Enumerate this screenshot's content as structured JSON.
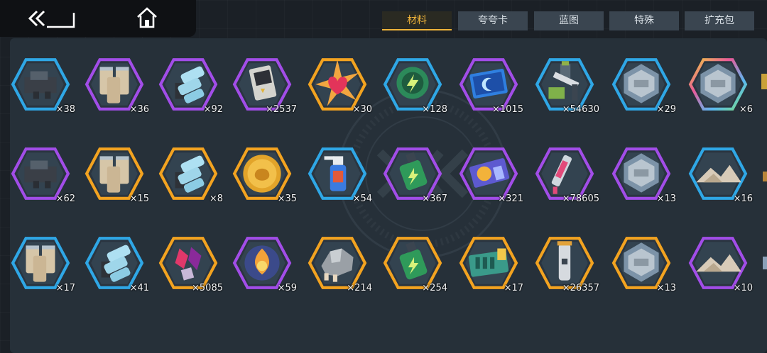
{
  "colors": {
    "active_tab": "#f0b43a",
    "tab_bg": "#3a4550",
    "rarity": {
      "blue": "#2fa7e6",
      "purple": "#a24de8",
      "gold": "#f3a320",
      "rainbow": "#e85a9a"
    }
  },
  "nav": {
    "back_icon": "double-chevron-back-icon",
    "home_icon": "home-icon"
  },
  "tabs": [
    {
      "label": "材料",
      "active": true
    },
    {
      "label": "夸夸卡",
      "active": false
    },
    {
      "label": "蓝图",
      "active": false
    },
    {
      "label": "特殊",
      "active": false
    },
    {
      "label": "扩充包",
      "active": false
    }
  ],
  "items": [
    {
      "qty": "×38",
      "rarity": "blue",
      "icon": "dark-machine-part-icon"
    },
    {
      "qty": "×36",
      "rarity": "purple",
      "icon": "battery-pack-icon"
    },
    {
      "qty": "×92",
      "rarity": "purple",
      "icon": "capacitor-cluster-icon"
    },
    {
      "qty": "×2537",
      "rarity": "purple",
      "icon": "battery-cell-icon"
    },
    {
      "qty": "×30",
      "rarity": "gold",
      "icon": "heart-burst-icon"
    },
    {
      "qty": "×128",
      "rarity": "blue",
      "icon": "energy-chip-icon"
    },
    {
      "qty": "×1015",
      "rarity": "purple",
      "icon": "moon-card-icon"
    },
    {
      "qty": "×54630",
      "rarity": "blue",
      "icon": "robot-arm-icon"
    },
    {
      "qty": "×29",
      "rarity": "blue",
      "icon": "hex-plate-icon"
    },
    {
      "qty": "×6",
      "rarity": "rainbow",
      "icon": "hex-plate-icon"
    },
    {
      "qty": "×62",
      "rarity": "purple",
      "icon": "dark-machine-part-icon"
    },
    {
      "qty": "×15",
      "rarity": "gold",
      "icon": "battery-pack-icon"
    },
    {
      "qty": "×8",
      "rarity": "gold",
      "icon": "capacitor-cluster-icon"
    },
    {
      "qty": "×35",
      "rarity": "gold",
      "icon": "gold-coin-icon"
    },
    {
      "qty": "×54",
      "rarity": "blue",
      "icon": "spray-bottle-icon"
    },
    {
      "qty": "×367",
      "rarity": "purple",
      "icon": "energy-drink-icon"
    },
    {
      "qty": "×321",
      "rarity": "purple",
      "icon": "ticket-icon"
    },
    {
      "qty": "×78605",
      "rarity": "purple",
      "icon": "syringe-icon"
    },
    {
      "qty": "×13",
      "rarity": "purple",
      "icon": "hex-plate-icon"
    },
    {
      "qty": "×16",
      "rarity": "blue",
      "icon": "powder-pile-icon"
    },
    {
      "qty": "×17",
      "rarity": "blue",
      "icon": "battery-pack-icon"
    },
    {
      "qty": "×41",
      "rarity": "blue",
      "icon": "capacitor-cluster-icon"
    },
    {
      "qty": "×5085",
      "rarity": "gold",
      "icon": "crystal-shards-icon"
    },
    {
      "qty": "×59",
      "rarity": "purple",
      "icon": "flame-orb-icon"
    },
    {
      "qty": "×214",
      "rarity": "gold",
      "icon": "ore-chunk-icon"
    },
    {
      "qty": "×254",
      "rarity": "gold",
      "icon": "energy-drink-icon"
    },
    {
      "qty": "×17",
      "rarity": "gold",
      "icon": "blueprint-card-icon"
    },
    {
      "qty": "×26357",
      "rarity": "gold",
      "icon": "device-rod-icon"
    },
    {
      "qty": "×13",
      "rarity": "gold",
      "icon": "hex-plate-icon"
    },
    {
      "qty": "×10",
      "rarity": "purple",
      "icon": "powder-pile-icon"
    }
  ]
}
